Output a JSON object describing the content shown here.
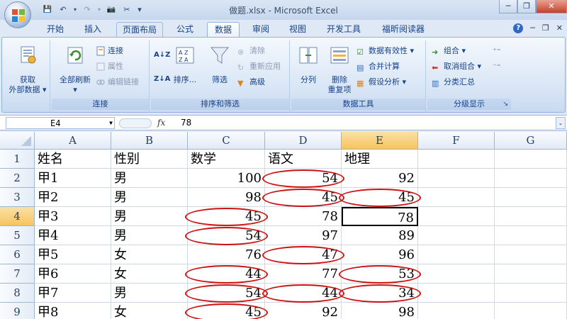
{
  "window": {
    "title": "做题.xlsx - Microsoft Excel",
    "min": "─",
    "restore": "❐",
    "close": "✕"
  },
  "qat": {
    "save": "💾",
    "undo": "↶",
    "redo": "↷",
    "camera": "📷",
    "tools": "✂",
    "more": "▾"
  },
  "tabs": [
    "开始",
    "插入",
    "页面布局",
    "公式",
    "数据",
    "审阅",
    "视图",
    "开发工具",
    "福昕阅读器"
  ],
  "active_tab": "数据",
  "ribbon": {
    "get_external": {
      "line1": "获取",
      "line2": "外部数据 ▾"
    },
    "connections": {
      "label": "连接",
      "refresh_all": "全部刷新",
      "refresh_dd": "▾",
      "connections": "连接",
      "properties": "属性",
      "edit_links": "编辑链接"
    },
    "sort_filter": {
      "label": "排序和筛选",
      "sort": "排序...",
      "filter": "筛选",
      "clear": "清除",
      "reapply": "重新应用",
      "advanced": "高级"
    },
    "data_tools": {
      "label": "数据工具",
      "text_to_columns": "分列",
      "remove_dup_1": "删除",
      "remove_dup_2": "重复项",
      "validation": "数据有效性 ▾",
      "consolidate": "合并计算",
      "what_if": "假设分析 ▾"
    },
    "outline": {
      "label": "分级显示",
      "group": "组合 ▾",
      "ungroup": "取消组合 ▾",
      "subtotal": "分类汇总"
    }
  },
  "formula_bar": {
    "name_box": "E4",
    "fx": "fx",
    "value": "78"
  },
  "columns": [
    "A",
    "B",
    "C",
    "D",
    "E",
    "F",
    "G"
  ],
  "active_col": "E",
  "active_row": "4",
  "rows": [
    {
      "n": "1",
      "cells": [
        "姓名",
        "性别",
        "数学",
        "语文",
        "地理",
        "",
        ""
      ]
    },
    {
      "n": "2",
      "cells": [
        "甲1",
        "男",
        "100",
        "54",
        "92",
        "",
        ""
      ]
    },
    {
      "n": "3",
      "cells": [
        "甲2",
        "男",
        "98",
        "45",
        "45",
        "",
        ""
      ]
    },
    {
      "n": "4",
      "cells": [
        "甲3",
        "男",
        "45",
        "78",
        "78",
        "",
        ""
      ]
    },
    {
      "n": "5",
      "cells": [
        "甲4",
        "男",
        "54",
        "97",
        "89",
        "",
        ""
      ]
    },
    {
      "n": "6",
      "cells": [
        "甲5",
        "女",
        "76",
        "47",
        "96",
        "",
        ""
      ]
    },
    {
      "n": "7",
      "cells": [
        "甲6",
        "女",
        "44",
        "77",
        "53",
        "",
        ""
      ]
    },
    {
      "n": "8",
      "cells": [
        "甲7",
        "男",
        "54",
        "44",
        "34",
        "",
        ""
      ]
    },
    {
      "n": "9",
      "cells": [
        "甲8",
        "女",
        "45",
        "92",
        "98",
        "",
        ""
      ]
    }
  ],
  "colors": {
    "circle": "#cc1111",
    "selection": "#f6c45d",
    "ribbon_text": "#15428b"
  }
}
